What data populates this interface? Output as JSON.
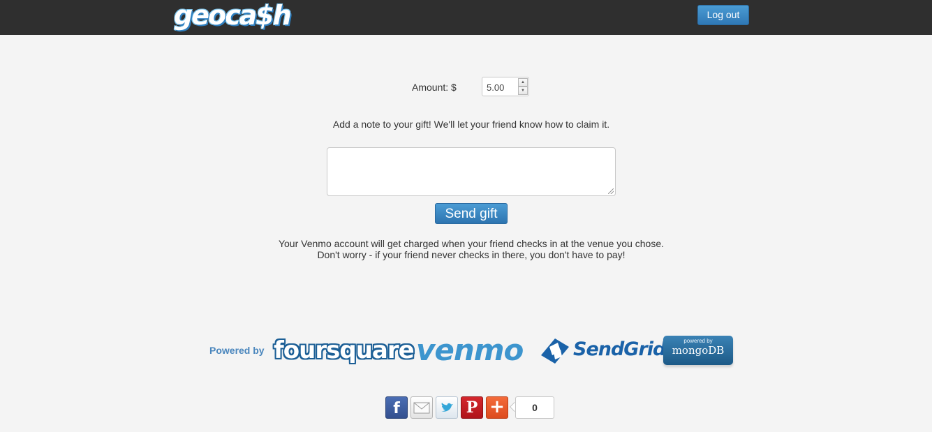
{
  "header": {
    "logo_text": "geoca$h",
    "logout_label": "Log out"
  },
  "form": {
    "amount_label": "Amount: $",
    "amount_value": "5.00",
    "note_prompt": "Add a note to your gift! We'll let your friend know how to claim it.",
    "note_value": "",
    "send_label": "Send gift",
    "charge_note_line1": "Your Venmo account will get charged when your friend checks in at the venue you chose.",
    "charge_note_line2": "Don't worry - if your friend never checks in there, you don't have to pay!"
  },
  "footer": {
    "powered_by_label": "Powered by",
    "logos": {
      "foursquare": "foursquare",
      "venmo": "venmo",
      "sendgrid": "SendGrid",
      "mongo_small": "powered by",
      "mongo_big": "mongoDB"
    },
    "share": {
      "buttons": [
        "facebook-icon",
        "email-icon",
        "twitter-icon",
        "pinterest-icon",
        "plus-icon"
      ],
      "count": "0"
    }
  },
  "colors": {
    "header_bg": "#2f2f2f",
    "accent_blue": "#2f78b5",
    "page_bg": "#f4f4f4",
    "venmo_blue": "#3d95ce",
    "powered_by_blue": "#4a86bd"
  }
}
